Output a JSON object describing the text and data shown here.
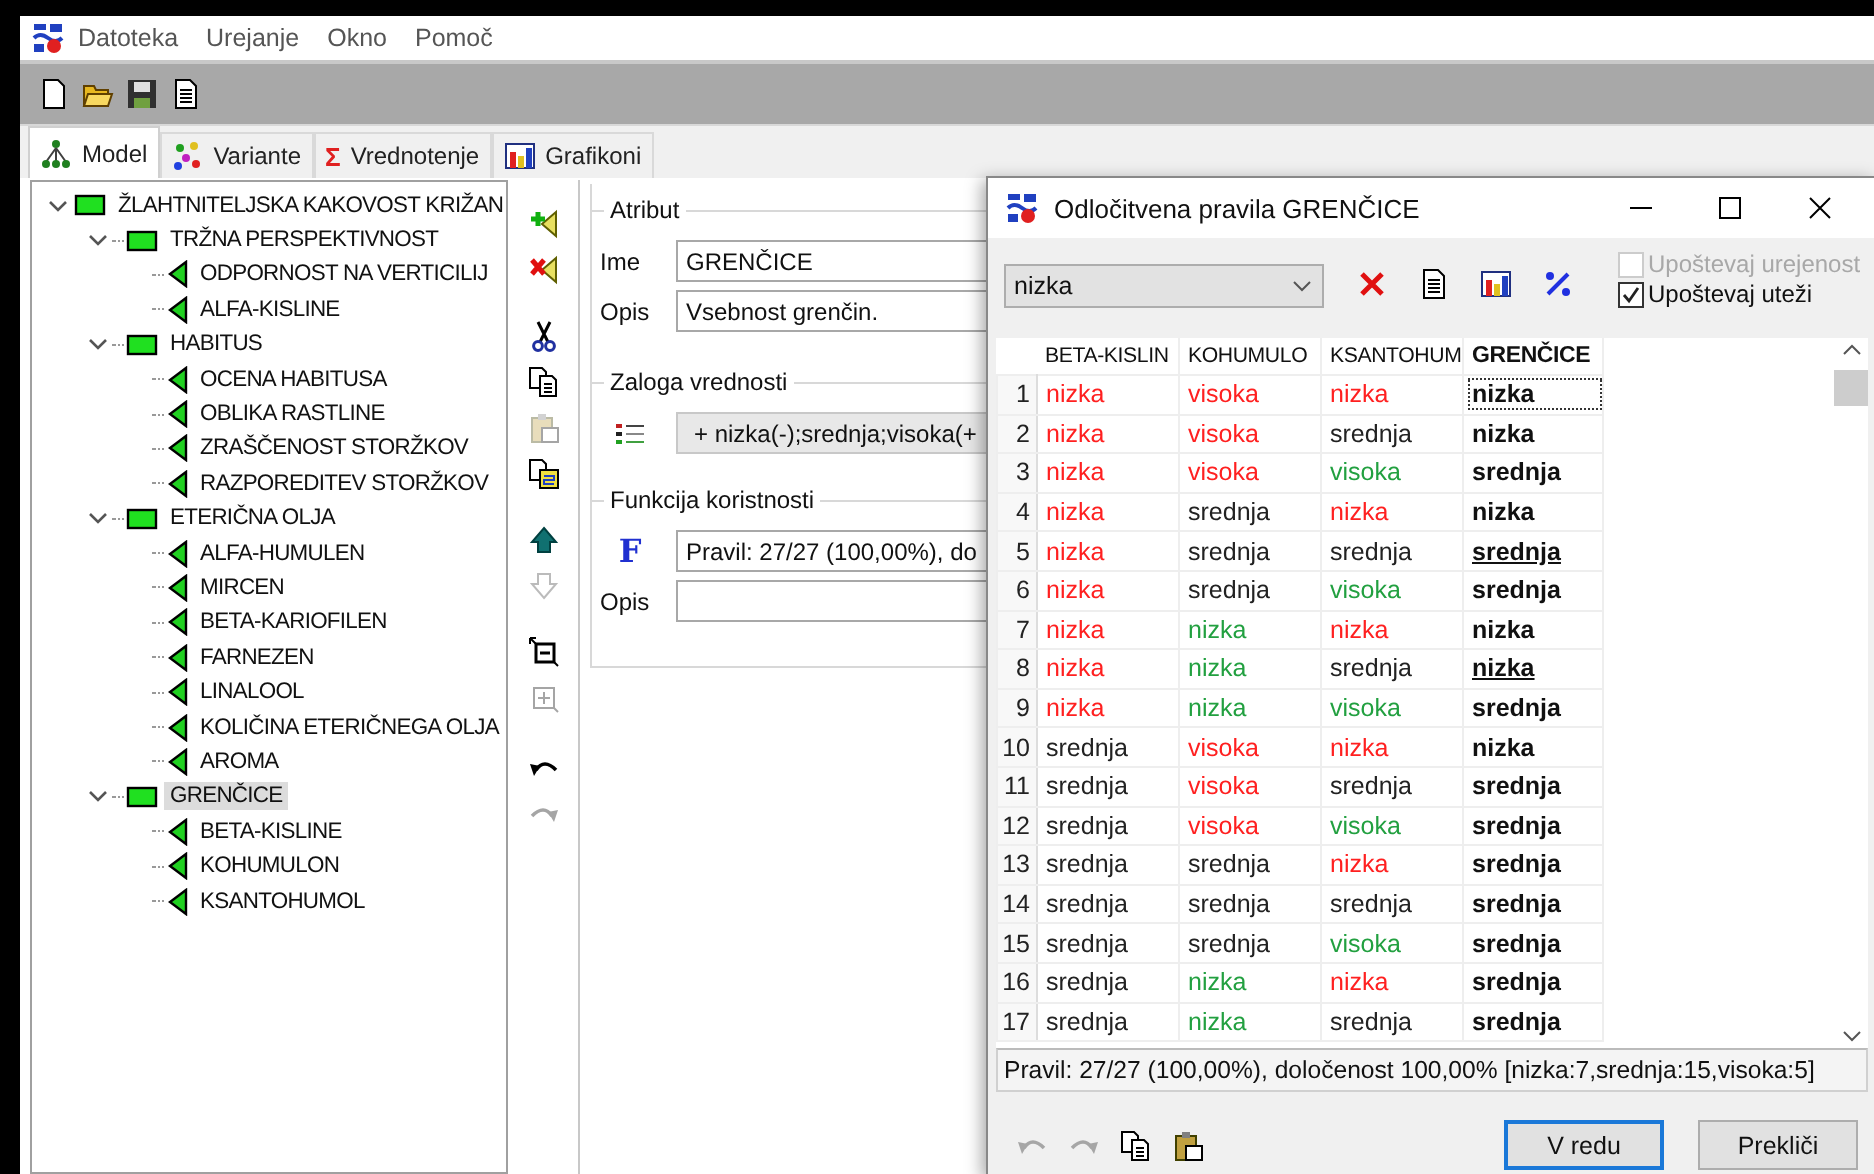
{
  "menu": [
    "Datoteka",
    "Urejanje",
    "Okno",
    "Pomoč"
  ],
  "toolbar": [
    {
      "kind": "new"
    },
    {
      "kind": "open"
    },
    {
      "kind": "save"
    },
    {
      "kind": "report"
    }
  ],
  "tabs": [
    {
      "label": "Model",
      "kind": "model",
      "selected": true
    },
    {
      "label": "Variante",
      "kind": "variants",
      "selected": false
    },
    {
      "label": "Vrednotenje",
      "kind": "sum",
      "icon": "Σ",
      "selected": false
    },
    {
      "label": "Grafikoni",
      "kind": "chart",
      "selected": false
    }
  ],
  "tree": [
    {
      "label": "ŽLAHTNITELJSKA KAKOVOST KRIŽAN",
      "kind": "aggregate",
      "expanded": true,
      "selected": false,
      "children": [
        {
          "label": "TRŽNA PERSPEKTIVNOST",
          "kind": "aggregate",
          "expanded": true,
          "selected": false,
          "children": [
            {
              "label": "ODPORNOST NA VERTICILIJ",
              "kind": "basic",
              "selected": false
            },
            {
              "label": "ALFA-KISLINE",
              "kind": "basic",
              "selected": false
            }
          ]
        },
        {
          "label": "HABITUS",
          "kind": "aggregate",
          "expanded": true,
          "selected": false,
          "children": [
            {
              "label": "OCENA HABITUSA",
              "kind": "basic",
              "selected": false
            },
            {
              "label": "OBLIKA RASTLINE",
              "kind": "basic",
              "selected": false
            },
            {
              "label": "ZRAŠČENOST STORŽKOV",
              "kind": "basic",
              "selected": false
            },
            {
              "label": "RAZPOREDITEV STORŽKOV",
              "kind": "basic",
              "selected": false
            }
          ]
        },
        {
          "label": "ETERIČNA OLJA",
          "kind": "aggregate",
          "expanded": true,
          "selected": false,
          "children": [
            {
              "label": "ALFA-HUMULEN",
              "kind": "basic",
              "selected": false
            },
            {
              "label": "MIRCEN",
              "kind": "basic",
              "selected": false
            },
            {
              "label": "BETA-KARIOFILEN",
              "kind": "basic",
              "selected": false
            },
            {
              "label": "FARNEZEN",
              "kind": "basic",
              "selected": false
            },
            {
              "label": "LINALOOL",
              "kind": "basic",
              "selected": false
            },
            {
              "label": "KOLIČINA ETERIČNEGA OLJA",
              "kind": "basic",
              "selected": false
            },
            {
              "label": "AROMA",
              "kind": "basic",
              "selected": false
            }
          ]
        },
        {
          "label": "GRENČICE",
          "kind": "aggregate",
          "expanded": true,
          "selected": true,
          "children": [
            {
              "label": "BETA-KISLINE",
              "kind": "basic",
              "selected": false
            },
            {
              "label": "KOHUMULON",
              "kind": "basic",
              "selected": false
            },
            {
              "label": "KSANTOHUMOL",
              "kind": "basic",
              "selected": false
            }
          ]
        }
      ]
    }
  ],
  "side_tools": [
    {
      "kind": "add",
      "disabled": false
    },
    {
      "kind": "delete",
      "disabled": false
    },
    {
      "kind": "cut",
      "disabled": false
    },
    {
      "kind": "copy",
      "disabled": false
    },
    {
      "kind": "paste",
      "disabled": true
    },
    {
      "kind": "paste_special",
      "disabled": false
    },
    {
      "kind": "up",
      "disabled": false
    },
    {
      "kind": "down",
      "disabled": true
    },
    {
      "kind": "collapse",
      "disabled": false
    },
    {
      "kind": "expand",
      "disabled": true
    },
    {
      "kind": "undo",
      "disabled": false
    },
    {
      "kind": "redo",
      "disabled": true
    }
  ],
  "attribute": {
    "title": "Atribut",
    "name_label": "Ime",
    "name": "GRENČICE",
    "desc_label": "Opis",
    "description": "Vsebnost grenčin."
  },
  "value_scale": {
    "title": "Zaloga vrednosti",
    "value": "+ nizka(-);srednja;visoka(+"
  },
  "utility": {
    "title": "Funkcija koristnosti",
    "icon": "F",
    "value": "Pravil: 27/27 (100,00%), do",
    "desc_label": "Opis"
  },
  "dialog": {
    "title": "Odločitvena pravila GRENČICE",
    "class_select": "nizka",
    "tools": [
      {
        "kind": "delete"
      },
      {
        "kind": "report"
      },
      {
        "kind": "chart"
      },
      {
        "kind": "percent"
      }
    ],
    "options": [
      {
        "label": "Upoštevaj urejenost",
        "checked": false,
        "disabled": true
      },
      {
        "label": "Upoštevaj uteži",
        "checked": true,
        "disabled": false
      }
    ],
    "columns": [
      "BETA-KISLIN",
      "KOHUMULO",
      "KSANTOHUM",
      "GRENČICE"
    ],
    "rows": [
      {
        "number": "1",
        "cells": [
          {
            "text": "nizka",
            "color": "#ff2020"
          },
          {
            "text": "visoka",
            "color": "#ff2020"
          },
          {
            "text": "nizka",
            "color": "#ff2020"
          }
        ],
        "result": {
          "text": "nizka",
          "underlined": false,
          "focused": true
        }
      },
      {
        "number": "2",
        "cells": [
          {
            "text": "nizka",
            "color": "#ff2020"
          },
          {
            "text": "visoka",
            "color": "#ff2020"
          },
          {
            "text": "srednja",
            "color": "#222222"
          }
        ],
        "result": {
          "text": "nizka",
          "underlined": false,
          "focused": false
        }
      },
      {
        "number": "3",
        "cells": [
          {
            "text": "nizka",
            "color": "#ff2020"
          },
          {
            "text": "visoka",
            "color": "#ff2020"
          },
          {
            "text": "visoka",
            "color": "#22a040"
          }
        ],
        "result": {
          "text": "srednja",
          "underlined": false,
          "focused": false
        }
      },
      {
        "number": "4",
        "cells": [
          {
            "text": "nizka",
            "color": "#ff2020"
          },
          {
            "text": "srednja",
            "color": "#222222"
          },
          {
            "text": "nizka",
            "color": "#ff2020"
          }
        ],
        "result": {
          "text": "nizka",
          "underlined": false,
          "focused": false
        }
      },
      {
        "number": "5",
        "cells": [
          {
            "text": "nizka",
            "color": "#ff2020"
          },
          {
            "text": "srednja",
            "color": "#222222"
          },
          {
            "text": "srednja",
            "color": "#222222"
          }
        ],
        "result": {
          "text": "srednja",
          "underlined": true,
          "focused": false
        }
      },
      {
        "number": "6",
        "cells": [
          {
            "text": "nizka",
            "color": "#ff2020"
          },
          {
            "text": "srednja",
            "color": "#222222"
          },
          {
            "text": "visoka",
            "color": "#22a040"
          }
        ],
        "result": {
          "text": "srednja",
          "underlined": false,
          "focused": false
        }
      },
      {
        "number": "7",
        "cells": [
          {
            "text": "nizka",
            "color": "#ff2020"
          },
          {
            "text": "nizka",
            "color": "#22a040"
          },
          {
            "text": "nizka",
            "color": "#ff2020"
          }
        ],
        "result": {
          "text": "nizka",
          "underlined": false,
          "focused": false
        }
      },
      {
        "number": "8",
        "cells": [
          {
            "text": "nizka",
            "color": "#ff2020"
          },
          {
            "text": "nizka",
            "color": "#22a040"
          },
          {
            "text": "srednja",
            "color": "#222222"
          }
        ],
        "result": {
          "text": "nizka",
          "underlined": true,
          "focused": false
        }
      },
      {
        "number": "9",
        "cells": [
          {
            "text": "nizka",
            "color": "#ff2020"
          },
          {
            "text": "nizka",
            "color": "#22a040"
          },
          {
            "text": "visoka",
            "color": "#22a040"
          }
        ],
        "result": {
          "text": "srednja",
          "underlined": false,
          "focused": false
        }
      },
      {
        "number": "10",
        "cells": [
          {
            "text": "srednja",
            "color": "#222222"
          },
          {
            "text": "visoka",
            "color": "#ff2020"
          },
          {
            "text": "nizka",
            "color": "#ff2020"
          }
        ],
        "result": {
          "text": "nizka",
          "underlined": false,
          "focused": false
        }
      },
      {
        "number": "11",
        "cells": [
          {
            "text": "srednja",
            "color": "#222222"
          },
          {
            "text": "visoka",
            "color": "#ff2020"
          },
          {
            "text": "srednja",
            "color": "#222222"
          }
        ],
        "result": {
          "text": "srednja",
          "underlined": false,
          "focused": false
        }
      },
      {
        "number": "12",
        "cells": [
          {
            "text": "srednja",
            "color": "#222222"
          },
          {
            "text": "visoka",
            "color": "#ff2020"
          },
          {
            "text": "visoka",
            "color": "#22a040"
          }
        ],
        "result": {
          "text": "srednja",
          "underlined": false,
          "focused": false
        }
      },
      {
        "number": "13",
        "cells": [
          {
            "text": "srednja",
            "color": "#222222"
          },
          {
            "text": "srednja",
            "color": "#222222"
          },
          {
            "text": "nizka",
            "color": "#ff2020"
          }
        ],
        "result": {
          "text": "srednja",
          "underlined": false,
          "focused": false
        }
      },
      {
        "number": "14",
        "cells": [
          {
            "text": "srednja",
            "color": "#222222"
          },
          {
            "text": "srednja",
            "color": "#222222"
          },
          {
            "text": "srednja",
            "color": "#222222"
          }
        ],
        "result": {
          "text": "srednja",
          "underlined": false,
          "focused": false
        }
      },
      {
        "number": "15",
        "cells": [
          {
            "text": "srednja",
            "color": "#222222"
          },
          {
            "text": "srednja",
            "color": "#222222"
          },
          {
            "text": "visoka",
            "color": "#22a040"
          }
        ],
        "result": {
          "text": "srednja",
          "underlined": false,
          "focused": false
        }
      },
      {
        "number": "16",
        "cells": [
          {
            "text": "srednja",
            "color": "#222222"
          },
          {
            "text": "nizka",
            "color": "#22a040"
          },
          {
            "text": "nizka",
            "color": "#ff2020"
          }
        ],
        "result": {
          "text": "srednja",
          "underlined": false,
          "focused": false
        }
      },
      {
        "number": "17",
        "cells": [
          {
            "text": "srednja",
            "color": "#222222"
          },
          {
            "text": "nizka",
            "color": "#22a040"
          },
          {
            "text": "srednja",
            "color": "#222222"
          }
        ],
        "result": {
          "text": "srednja",
          "underlined": false,
          "focused": false
        }
      }
    ],
    "status": "Pravil: 27/27 (100,00%), določenost 100,00% [nizka:7,srednja:15,visoka:5]",
    "bottom_tools": [
      {
        "kind": "undo",
        "disabled": true
      },
      {
        "kind": "redo",
        "disabled": true
      },
      {
        "kind": "copy",
        "disabled": false
      },
      {
        "kind": "paste",
        "disabled": false
      }
    ],
    "buttons": [
      {
        "label": "V redu",
        "default": true
      },
      {
        "label": "Prekliči",
        "default": false
      }
    ]
  }
}
